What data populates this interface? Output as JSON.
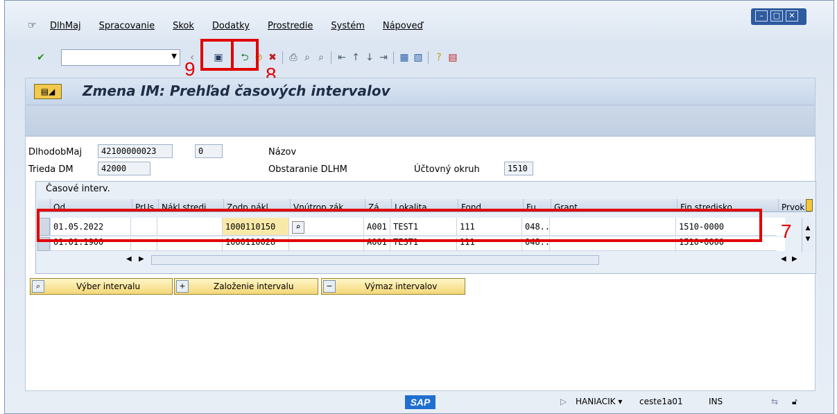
{
  "window": {
    "controls": [
      "–",
      "□",
      "✕"
    ]
  },
  "menu": [
    "DlhMaj",
    "Spracovanie",
    "Skok",
    "Dodatky",
    "Prostredie",
    "Systém",
    "Nápoveď"
  ],
  "toolbar": {
    "command_value": "",
    "icons": [
      "enter-icon",
      "save-icon",
      "back-icon",
      "exit-icon",
      "cancel-icon",
      "print-icon",
      "find-icon",
      "find-next-icon",
      "first-page-icon",
      "previous-page-icon",
      "next-page-icon",
      "last-page-icon",
      "create-session-icon",
      "shortcut-icon",
      "help-icon",
      "layout-icon"
    ]
  },
  "annotations": {
    "save": "9",
    "back": "8",
    "row": "7"
  },
  "title": "Zmena IM: Prehľad časových intervalov",
  "header": {
    "asset_label": "DlhodobMaj",
    "asset_value": "42100000023",
    "subnumber_value": "0",
    "name_label": "Názov",
    "class_label": "Trieda DM",
    "class_value": "42000",
    "description": "Obstaranie DLHM",
    "area_label": "Účtovný okruh",
    "area_value": "1510"
  },
  "table": {
    "title": "Časové interv.",
    "columns": [
      "Od",
      "PrUs",
      "Nákl.stredi",
      "Zodp.nákl.",
      "Vnútrop.zák.",
      "Zá...",
      "Lokalita",
      "Fond",
      "Fu...",
      "Grant",
      "Fin.stredisko",
      "Prvok"
    ],
    "rows": [
      [
        "01.05.2022",
        "",
        "",
        "1000110150",
        "",
        "A001",
        "TEST1",
        "111",
        "048...",
        "",
        "1510-0000",
        ""
      ],
      [
        "01.01.1900",
        "",
        "",
        "1000110028",
        "",
        "A001",
        "TEST1",
        "111",
        "048...",
        "",
        "1510-0000",
        ""
      ]
    ]
  },
  "buttons": {
    "select": "Výber intervalu",
    "create": "Založenie intervalu",
    "delete": "Výmaz intervalov"
  },
  "status": {
    "sap": "SAP",
    "user": "HANIACIK",
    "server": "ceste1a01",
    "mode": "INS"
  }
}
